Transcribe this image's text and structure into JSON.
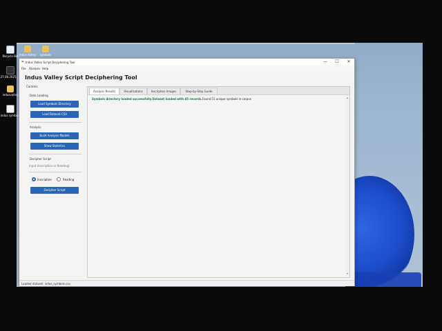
{
  "desktop": {
    "icons": [
      {
        "label": "Recycle Bin"
      },
      {
        "label": "Indus Valley"
      },
      {
        "label": "symbols"
      },
      {
        "label": "27.08.2025_..."
      },
      {
        "label": "indusvalley"
      },
      {
        "label": "indus symbols"
      }
    ]
  },
  "window": {
    "title": "Indus Valley Script Deciphering Tool",
    "controls": {
      "minimize": "—",
      "maximize": "☐",
      "close": "✕"
    },
    "menu": [
      "File",
      "Analysis",
      "Help"
    ],
    "app_title": "Indus Valley Script Deciphering Tool"
  },
  "controls_panel": {
    "title": "Controls",
    "data_loading": {
      "label": "Data Loading",
      "load_symbols": "Load Symbols Directory",
      "load_dataset": "Load Dataset CSV"
    },
    "analysis": {
      "label": "Analysis",
      "build_models": "Build Analysis Models",
      "show_statistics": "Show Statistics"
    },
    "decipher": {
      "label": "Decipher Script",
      "input_placeholder": "Input (Inscription or Reading)",
      "radio_inscription": "Inscription",
      "radio_reading": "Reading",
      "decipher_button": "Decipher Script"
    }
  },
  "tabs": [
    "Analysis Results",
    "Visualizations",
    "Inscription Images",
    "Step-by-Step Guide"
  ],
  "results": {
    "success_text": "Symbols directory loaded successfully.Dataset loaded with 45 records.",
    "info_text": "Found 51 unique symbols in corpus"
  },
  "status": {
    "text": "Loaded dataset: indus_symbols.csv"
  },
  "colors": {
    "accent": "#2a66b5",
    "success": "#137a3a"
  }
}
